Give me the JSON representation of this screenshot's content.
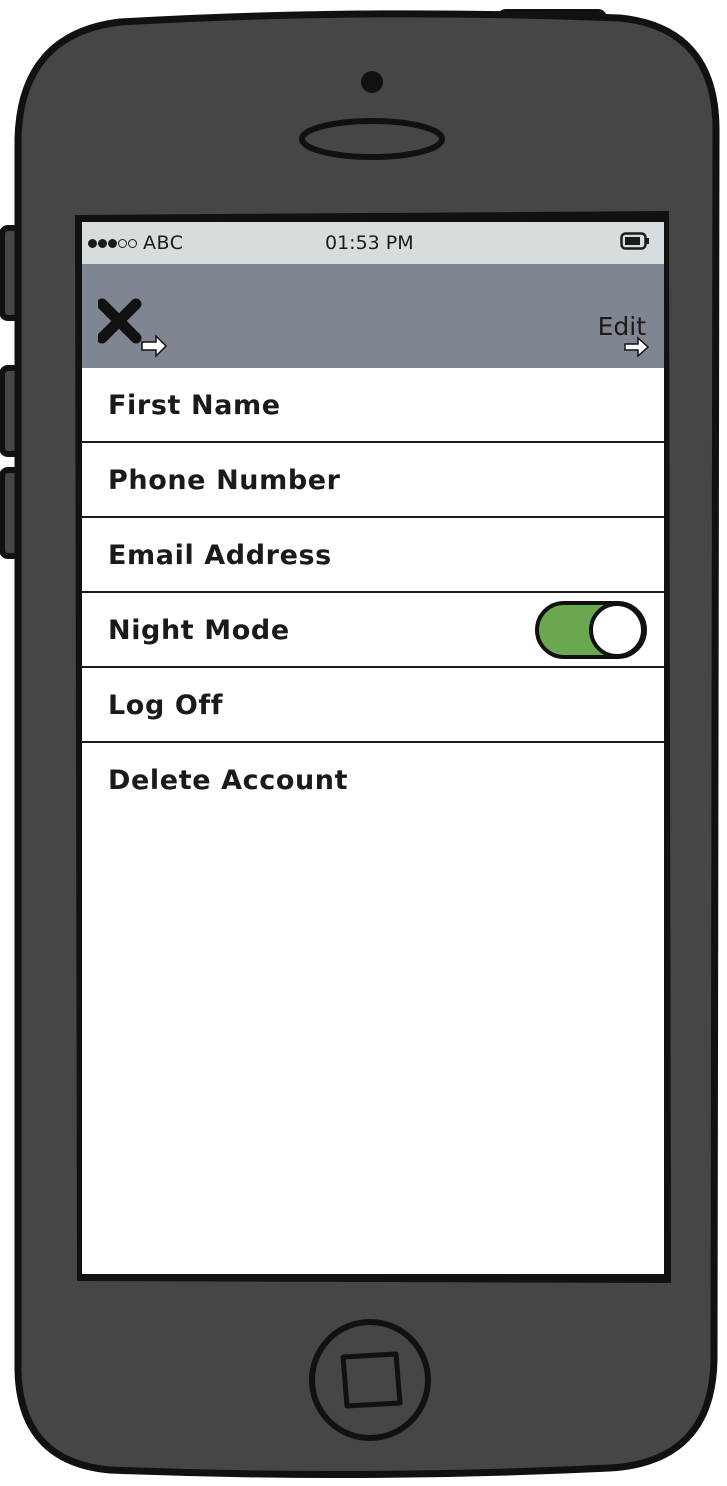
{
  "status_bar": {
    "signal_filled": 3,
    "signal_total": 5,
    "carrier": "ABC",
    "time": "01:53 PM",
    "battery_icon": "battery-icon"
  },
  "nav_bar": {
    "left_icon": "close-icon",
    "right_label": "Edit"
  },
  "settings": {
    "items": [
      {
        "label": "First Name"
      },
      {
        "label": "Phone Number"
      },
      {
        "label": "Email Address"
      },
      {
        "label": "Night Mode",
        "toggle_on": true
      },
      {
        "label": "Log Off"
      },
      {
        "label": "Delete Account"
      }
    ]
  },
  "colors": {
    "phone_body": "#464646",
    "nav_bar": "#808592",
    "status_bar": "#d7dcde",
    "toggle_on": "#6aa84f"
  }
}
